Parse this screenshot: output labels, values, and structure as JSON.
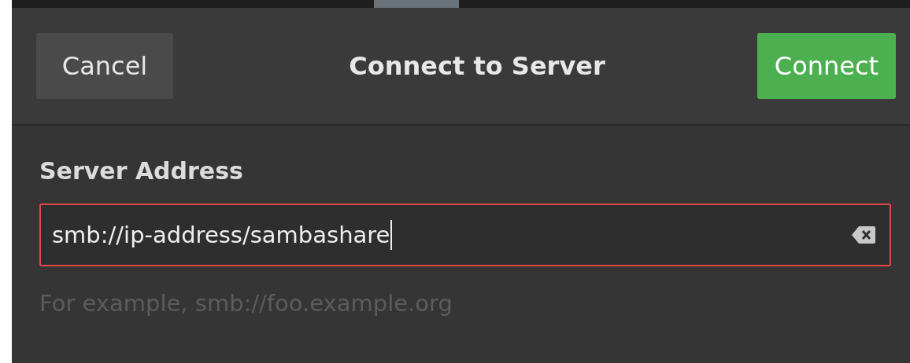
{
  "dialog": {
    "title": "Connect to Server",
    "cancel_button": "Cancel",
    "connect_button": "Connect"
  },
  "server_address": {
    "label": "Server Address",
    "value": "smb://ip-address/sambashare",
    "invalid": true,
    "hint": "For example, smb://foo.example.org"
  }
}
